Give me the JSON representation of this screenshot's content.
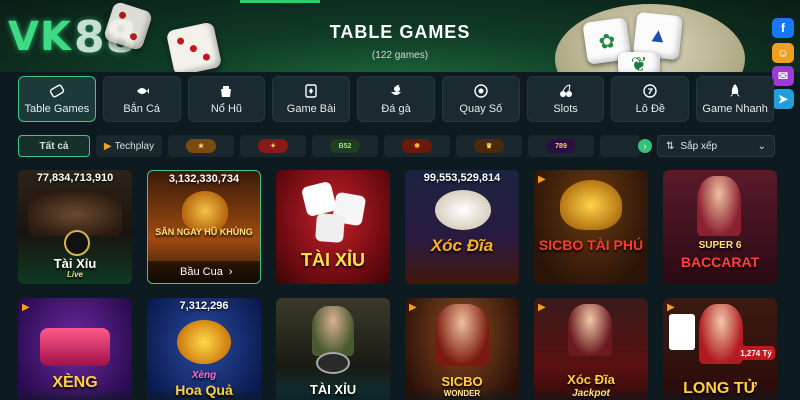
{
  "header": {
    "logo_prefix": "VK",
    "logo_number": "88",
    "title": "TABLE GAMES",
    "subtitle": "(122 games)"
  },
  "social": [
    {
      "icon": "facebook-icon",
      "glyph": "f",
      "color": "#1877f2"
    },
    {
      "icon": "group-icon",
      "glyph": "☺",
      "color": "#f0a020"
    },
    {
      "icon": "messenger-icon",
      "glyph": "✉",
      "color": "#9b3bd6"
    },
    {
      "icon": "telegram-icon",
      "glyph": "➤",
      "color": "#229ed9"
    }
  ],
  "categories": [
    {
      "label": "Table Games",
      "icon": "table-games-icon",
      "active": true
    },
    {
      "label": "Bắn Cá",
      "icon": "fish-icon",
      "active": false
    },
    {
      "label": "Nổ Hũ",
      "icon": "jackpot-pot-icon",
      "active": false
    },
    {
      "label": "Game Bài",
      "icon": "cards-icon",
      "active": false
    },
    {
      "label": "Đá gà",
      "icon": "rooster-icon",
      "active": false
    },
    {
      "label": "Quay Số",
      "icon": "lottery-ball-icon",
      "active": false
    },
    {
      "label": "Slots",
      "icon": "cherry-icon",
      "active": false
    },
    {
      "label": "Lô Đề",
      "icon": "number-ball-icon",
      "active": false
    },
    {
      "label": "Game Nhanh",
      "icon": "rocket-icon",
      "active": false
    }
  ],
  "providers": {
    "all_label": "Tất cả",
    "techplay_label": "Techplay",
    "logos": [
      "provider-logo-1",
      "provider-logo-2",
      "B52",
      "provider-logo-4",
      "provider-logo-5",
      "789"
    ],
    "sort_label": "Sắp xếp"
  },
  "games": [
    {
      "name": "Tài Xỉu",
      "sub": "Live",
      "jackpot": "77,834,713,910"
    },
    {
      "name": "Bầu Cua",
      "banner": "SĂN NGAY HŨ KHỦNG",
      "jackpot": "3,132,330,734",
      "selected": true
    },
    {
      "name": "TÀI XỈU",
      "jackpot": ""
    },
    {
      "name": "Xóc Đĩa",
      "jackpot": "99,553,529,814"
    },
    {
      "name": "SICBO TÀI PHÚ",
      "jackpot": ""
    },
    {
      "name": "BACCARAT",
      "badge": "SUPER 6",
      "jackpot": ""
    },
    {
      "name": "XÈNG",
      "jackpot": ""
    },
    {
      "name": "Hoa Quả",
      "badge": "Xèng",
      "jackpot": "7,312,296"
    },
    {
      "name": "TÀI XỈU",
      "jackpot": ""
    },
    {
      "name": "SICBO",
      "sub": "WONDER",
      "jackpot": ""
    },
    {
      "name": "Xóc Đĩa",
      "sub": "Jackpot",
      "jackpot": ""
    },
    {
      "name": "LONG TỬ",
      "badge": "1,274 Tỷ",
      "jackpot": ""
    }
  ],
  "colors": {
    "accent": "#38c987",
    "background": "#0d1a1f",
    "card": "#1a2a30"
  }
}
